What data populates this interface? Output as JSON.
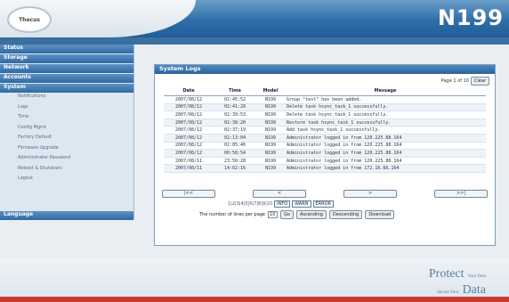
{
  "header": {
    "logo_text": "Thecus",
    "model": "N199"
  },
  "sidebar": {
    "categories": {
      "status": "Status",
      "storage": "Storage",
      "network": "Network",
      "accounts": "Accounts",
      "system": "System",
      "language": "Language"
    },
    "system_items": [
      "Notifications",
      "Logs",
      "Time",
      "Config Mgmt",
      "Factory Default",
      "Firmware Upgrade",
      "Administrator Password",
      "Reboot & Shutdown",
      "Logout"
    ]
  },
  "panel": {
    "title": "System Logs",
    "page_label": "Page 1 of 10",
    "clear_label": "Clear"
  },
  "table": {
    "headers": [
      "Date",
      "Time",
      "Model",
      "Message"
    ],
    "rows": [
      [
        "2007/08/12",
        "02:45:52",
        "N199",
        "Group \"test\" has been added."
      ],
      [
        "2007/08/12",
        "02:41:20",
        "N199",
        "Delete task hsync_task_1 successfully."
      ],
      [
        "2007/08/12",
        "02:39:53",
        "N199",
        "Delete task hsync_task_1 successfully."
      ],
      [
        "2007/08/12",
        "02:38:20",
        "N199",
        "Restore task hsync_task_1 successfully."
      ],
      [
        "2007/08/12",
        "02:37:19",
        "N199",
        "Add task hsync_task_1 successfully."
      ],
      [
        "2007/08/12",
        "02:13:04",
        "N199",
        "Administrator logged in from 120.225.88.164"
      ],
      [
        "2007/08/12",
        "02:05:46",
        "N199",
        "Administrator logged in from 120.225.88.164"
      ],
      [
        "2007/08/12",
        "00:58:54",
        "N199",
        "Administrator logged in from 120.225.88.164"
      ],
      [
        "2007/08/11",
        "23:50:28",
        "N199",
        "Administrator logged in from 120.225.88.164"
      ],
      [
        "2007/08/11",
        "14:02:16",
        "N199",
        "Administrator logged in from 172.16.66.164"
      ]
    ]
  },
  "navigation": {
    "first": "|<<",
    "prev": "<",
    "next": ">",
    "last": ">>|",
    "page_numbers": "1|2|3|4|5|6|7|8|9|10"
  },
  "filters": {
    "info": "INFO",
    "warn": "WARN",
    "error": "ERROR"
  },
  "controls": {
    "lines_label": "The number of lines per page",
    "lines_value": "10",
    "go": "Go",
    "ascending": "Ascending",
    "descending": "Descending",
    "download": "Download"
  },
  "footer": {
    "word1": "Protect",
    "small1": "Your Data",
    "small2": "Secure Your",
    "word2": "Data"
  },
  "colors": {
    "header_blue": "#2f6ea8",
    "accent_red": "#c83a2e"
  }
}
